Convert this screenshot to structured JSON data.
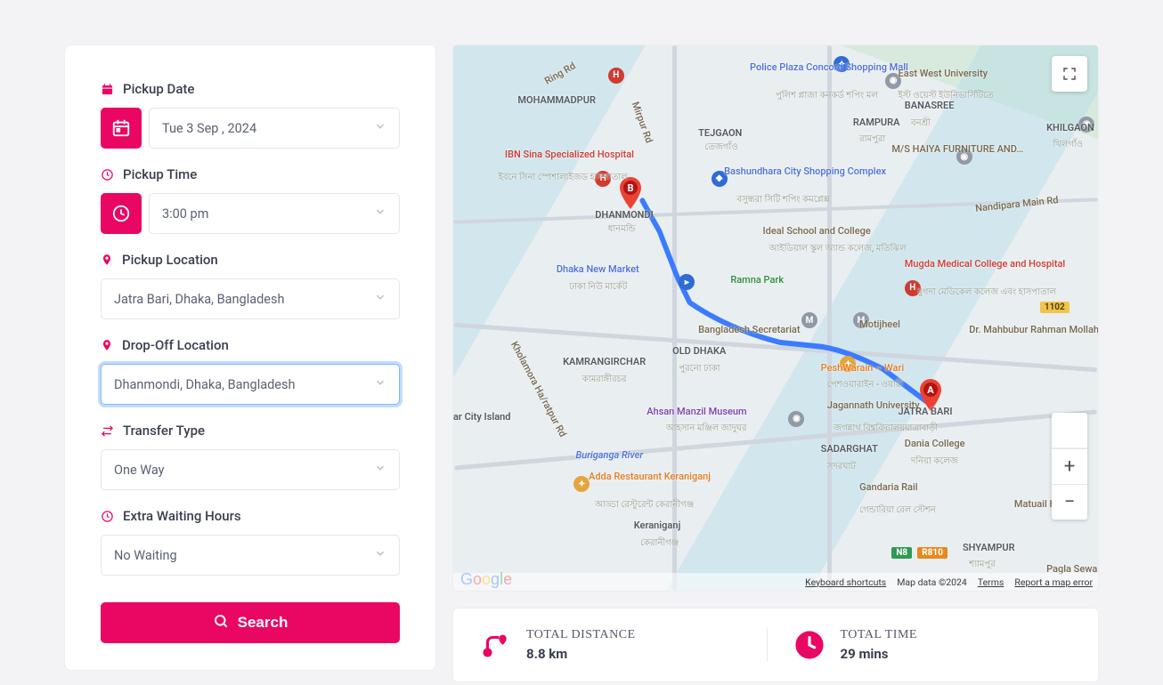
{
  "form": {
    "pickup_date": {
      "label": "Pickup Date",
      "value": "Tue 3 Sep , 2024"
    },
    "pickup_time": {
      "label": "Pickup Time",
      "value": "3:00 pm"
    },
    "pickup_location": {
      "label": "Pickup Location",
      "value": "Jatra Bari, Dhaka, Bangladesh"
    },
    "dropoff_location": {
      "label": "Drop-Off Location",
      "value": "Dhanmondi, Dhaka, Bangladesh"
    },
    "transfer_type": {
      "label": "Transfer Type",
      "value": "One Way"
    },
    "extra_waiting": {
      "label": "Extra Waiting Hours",
      "value": "No Waiting"
    },
    "search_label": "Search"
  },
  "map": {
    "attribution": {
      "keyboard": "Keyboard shortcuts",
      "data": "Map data ©2024",
      "terms": "Terms",
      "report": "Report a map error"
    },
    "markers": {
      "A": "A",
      "B": "B"
    },
    "labels": {
      "mohammadpur": "MOHAMMADPUR",
      "dhanmondi": "DHANMONDI",
      "dhanmondi_sub": "ধানমন্ডি",
      "ibn_sina": "IBN Sina Specialized Hospital",
      "ibn_sina_sub": "ইবনে সিনা স্পেশালাইজড হাসপাতাল",
      "dhaka_new_market": "Dhaka New Market",
      "dhaka_new_market_sub": "ঢাকা নিউ মার্কেট",
      "old_dhaka": "OLD DHAKA",
      "old_dhaka_sub": "পুরনো  ঢাকা",
      "ahsan_manzil": "Ahsan Manzil Museum",
      "ahsan_manzil_sub": "আহসান মঞ্জিল জাদুঘর",
      "kamrangirchar": "KAMRANGIRCHAR",
      "kamrangirchar_sub": "কামরাঙ্গীরচর",
      "buriganga": "Buriganga River",
      "keraniganj": "Keraniganj",
      "keraniganj_sub": "কেরানীগঞ্জ",
      "adda": "Adda Restaurant Keraniganj",
      "adda_sub": "আড্ডা রেস্টুরেন্ট কেরানীগঞ্জ",
      "ar_city": "ar City Island",
      "police_plaza": "Police Plaza Concord Shopping Mall",
      "police_plaza_sub": "পুলিশ প্লাজা কনকর্ড শপিং মল",
      "bashundhara": "Bashundhara City Shopping Complex",
      "bashundhara_sub": "বসুন্ধরা সিটি শপিং কমপ্লেক্স",
      "tejgaon": "TEJGAON",
      "tejgaon_sub": "তেজগাঁও",
      "ideal": "Ideal School and College",
      "ideal_sub": "আইডিয়াল স্কুল অ্যান্ড কলেজ, মতিঝিল",
      "ramna": "Ramna Park",
      "bd_sec": "Bangladesh Secretariat",
      "motijheel": "Motijheel",
      "peshwarain": "PeshWarain ~ Wari",
      "peshwarain_sub": "পেশওয়ারাইন - ওয়ারী",
      "jagannath": "Jagannath University",
      "jagannath_sub": "জগন্নাথ বিশ্ববিদ্যালয়",
      "jatra_bari": "JATRA BARI",
      "jatra_bari_sub": "যাত্রাবাড়ী",
      "sadarghat": "SADARGHAT",
      "sadarghat_sub": "সদরঘাট",
      "gandaria": "Gandaria Rail",
      "gandaria_sub": "গেন্ডারিয়া রেল স্টেশন",
      "dania": "Dania College",
      "dania_sub": "দনিয়া কলেজ",
      "shyampur": "SHYAMPUR",
      "shyampur_sub": "শ্যামপুর",
      "pagla": "Pagla Sewa",
      "matuail": "Matuail Hosp",
      "east_west": "East West University",
      "east_west_sub": "ইস্ট ওয়েস্ট ইউনিভার্সিটিতে",
      "rampura": "RAMPURA",
      "rampura_sub": "রামপুরা",
      "banasree": "BANASREE",
      "banasree_sub": "বনশ্রী",
      "haiya": "M/S HAIYA FURNITURE AND…",
      "khilgaon": "KHILGAON",
      "khilgaon_sub": "খিলগাঁও",
      "nandipara": "Nandipara Main Rd",
      "mugda": "Mugda Medical College and Hospital",
      "mugda_sub": "মুগদা মেডিকেল কলেজ এবং হাসপাতাল",
      "habibur": "Dr. Mahbubur Rahman Mollah College",
      "ring_rd": "Ring Rd",
      "mirpur_rd": "Mirpur Rd",
      "kholamora": "Kholamora Ha/ratpur Rd",
      "n8": "N8",
      "r810": "R810",
      "r1102": "1102"
    }
  },
  "stats": {
    "distance": {
      "title": "TOTAL DISTANCE",
      "value": "8.8 km"
    },
    "time": {
      "title": "TOTAL TIME",
      "value": "29 mins"
    }
  }
}
